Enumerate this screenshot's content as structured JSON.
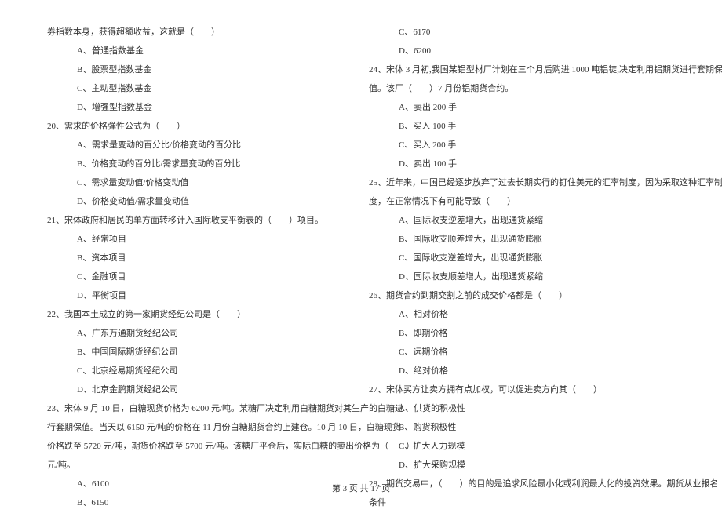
{
  "left": {
    "q_intro": "券指数本身，获得超额收益，这就是（　　）",
    "q_intro_A": "A、普通指数基金",
    "q_intro_B": "B、股票型指数基金",
    "q_intro_C": "C、主动型指数基金",
    "q_intro_D": "D、增强型指数基金",
    "q20": "20、需求的价格弹性公式为（　　）",
    "q20_A": "A、需求量变动的百分比/价格变动的百分比",
    "q20_B": "B、价格变动的百分比/需求量变动的百分比",
    "q20_C": "C、需求量变动值/价格变动值",
    "q20_D": "D、价格变动值/需求量变动值",
    "q21": "21、宋体政府和居民的单方面转移计入国际收支平衡表的（　　）项目。",
    "q21_A": "A、经常项目",
    "q21_B": "B、资本项目",
    "q21_C": "C、金融项目",
    "q21_D": "D、平衡项目",
    "q22": "22、我国本土成立的第一家期货经纪公司是（　　）",
    "q22_A": "A、广东万通期货经纪公司",
    "q22_B": "B、中国国际期货经纪公司",
    "q22_C": "C、北京经易期货经纪公司",
    "q22_D": "D、北京金鹏期货经纪公司",
    "q23_l1": "23、宋体 9 月 10 日，白糖现货价格为 6200 元/吨。某糖厂决定利用白糖期货对其生产的白糖进",
    "q23_l2": "行套期保值。当天以 6150 元/吨的价格在 11 月份白糖期货合约上建仓。10 月 10 日，白糖现货",
    "q23_l3": "价格跌至 5720 元/吨，期货价格跌至 5700 元/吨。该糖厂平仓后，实际白糖的卖出价格为（　　）",
    "q23_l4": "元/吨。",
    "q23_A": "A、6100",
    "q23_B": "B、6150"
  },
  "right": {
    "q23_C": "C、6170",
    "q23_D": "D、6200",
    "q24_l1": "24、宋体 3 月初,我国某铝型材厂计划在三个月后购进 1000 吨铝锭,决定利用铝期货进行套期保",
    "q24_l2": "值。该厂（　　）7 月份铝期货合约。",
    "q24_A": "A、卖出 200 手",
    "q24_B": "B、买入 100 手",
    "q24_C": "C、买入 200 手",
    "q24_D": "D、卖出 100 手",
    "q25_l1": "25、近年来，中国已经逐步放弃了过去长期实行的钉住美元的汇率制度，因为采取这种汇率制",
    "q25_l2": "度，在正常情况下有可能导致（　　）",
    "q25_A": "A、国际收支逆差增大，出现通货紧缩",
    "q25_B": "B、国际收支顺差增大，出现通货膨胀",
    "q25_C": "C、国际收支逆差增大，出现通货膨胀",
    "q25_D": "D、国际收支顺差增大，出现通货紧缩",
    "q26": "26、期货合约到期交割之前的成交价格都是（　　）",
    "q26_A": "A、相对价格",
    "q26_B": "B、即期价格",
    "q26_C": "C、远期价格",
    "q26_D": "D、绝对价格",
    "q27": "27、宋体买方让卖方拥有点加权，可以促进卖方向其（　　）",
    "q27_A": "A、供货的积极性",
    "q27_B": "B、购货积极性",
    "q27_C": "C、扩大人力规模",
    "q27_D": "D、扩大采购规模",
    "q28_l1": "28、期货交易中，（　　）的目的是追求风险最小化或利润最大化的投资效果。期货从业报名",
    "q28_l2": "条件"
  },
  "footer": "第 3 页 共 17 页"
}
